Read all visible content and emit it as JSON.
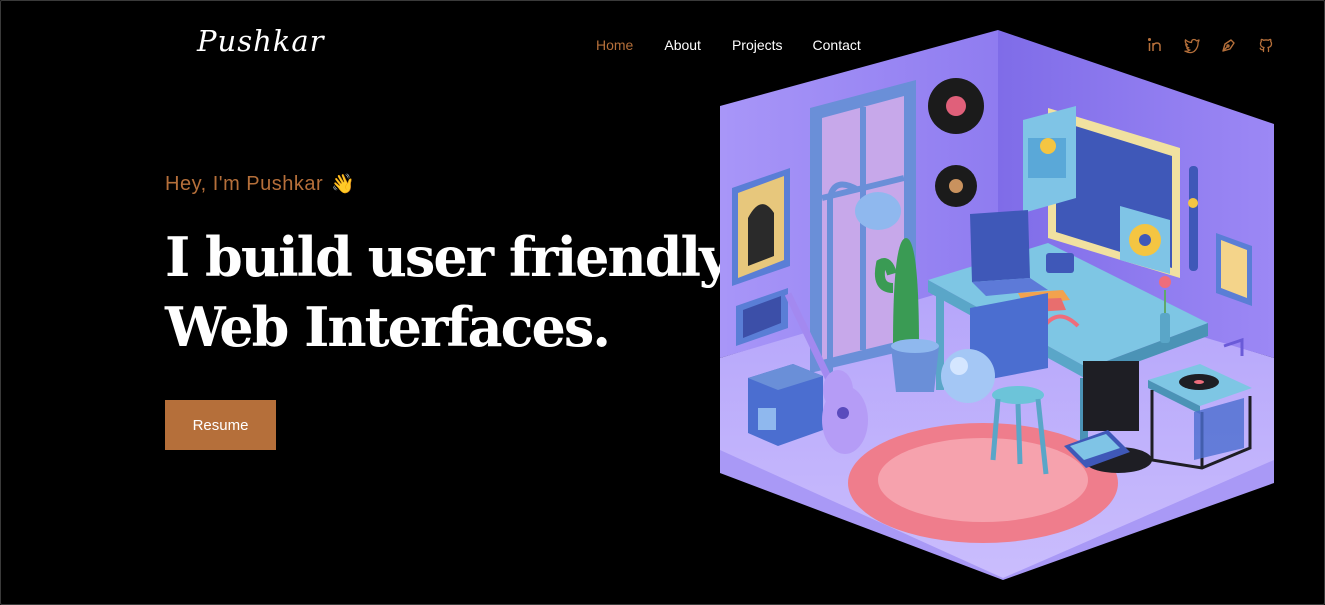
{
  "header": {
    "logo": "Pushkar",
    "nav": [
      "Home",
      "About",
      "Projects",
      "Contact"
    ],
    "active_nav": "Home",
    "socials": [
      "linkedin-icon",
      "twitter-icon",
      "pen-tool-icon",
      "github-icon"
    ]
  },
  "hero": {
    "greeting": "Hey, I'm Pushkar",
    "wave": "👋",
    "headline_line1": "I build user friendly",
    "headline_line2": "Web Interfaces.",
    "cta": "Resume"
  },
  "colors": {
    "background": "#000000",
    "accent": "#b56f3a",
    "text": "#ffffff",
    "room_purple": "#8f7bf0"
  }
}
